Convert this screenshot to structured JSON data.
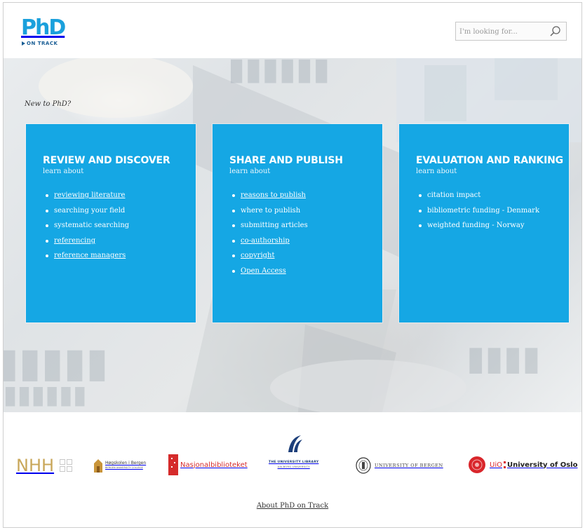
{
  "header": {
    "logo": {
      "main": "PhD",
      "sub": "ON TRACK"
    },
    "search": {
      "placeholder": "I'm looking for..."
    }
  },
  "hero": {
    "intro": "New to PhD?",
    "cards": [
      {
        "title": "REVIEW AND DISCOVER",
        "subtitle": "learn about",
        "links": [
          "reviewing literature",
          "searching your field",
          "systematic searching",
          "referencing",
          "reference managers"
        ]
      },
      {
        "title": "SHARE AND PUBLISH",
        "subtitle": "learn about",
        "links": [
          "reasons to publish",
          "where to publish",
          "submitting articles",
          "co-authorship",
          "copyright",
          "Open Access"
        ]
      },
      {
        "title": "EVALUATION AND RANKING",
        "subtitle": "learn about",
        "links": [
          "citation impact",
          "bibliometric funding - Denmark",
          "weighted funding - Norway"
        ]
      }
    ]
  },
  "partners": {
    "nhh": "NHH",
    "hib": {
      "name": "Høgskolen i Bergen",
      "tagline": "BERGEN UNIVERSITY COLLEGE"
    },
    "nb": "Nasjonalbiblioteket",
    "aau": {
      "line1": "THE UNIVERSITY LIBRARY",
      "line2": "AALBORG UNIVERSITY"
    },
    "uib": "UNIVERSITY OF BERGEN",
    "uio": {
      "abbr": "UiO",
      "name": "University of Oslo"
    }
  },
  "footer": {
    "about": "About PhD on Track"
  },
  "colors": {
    "card_blue": "#15a7e4",
    "logo_blue": "#1aa0dc",
    "nhh_gold": "#c9a75a",
    "nb_red": "#d52b2b",
    "uio_red": "#d9262b"
  }
}
